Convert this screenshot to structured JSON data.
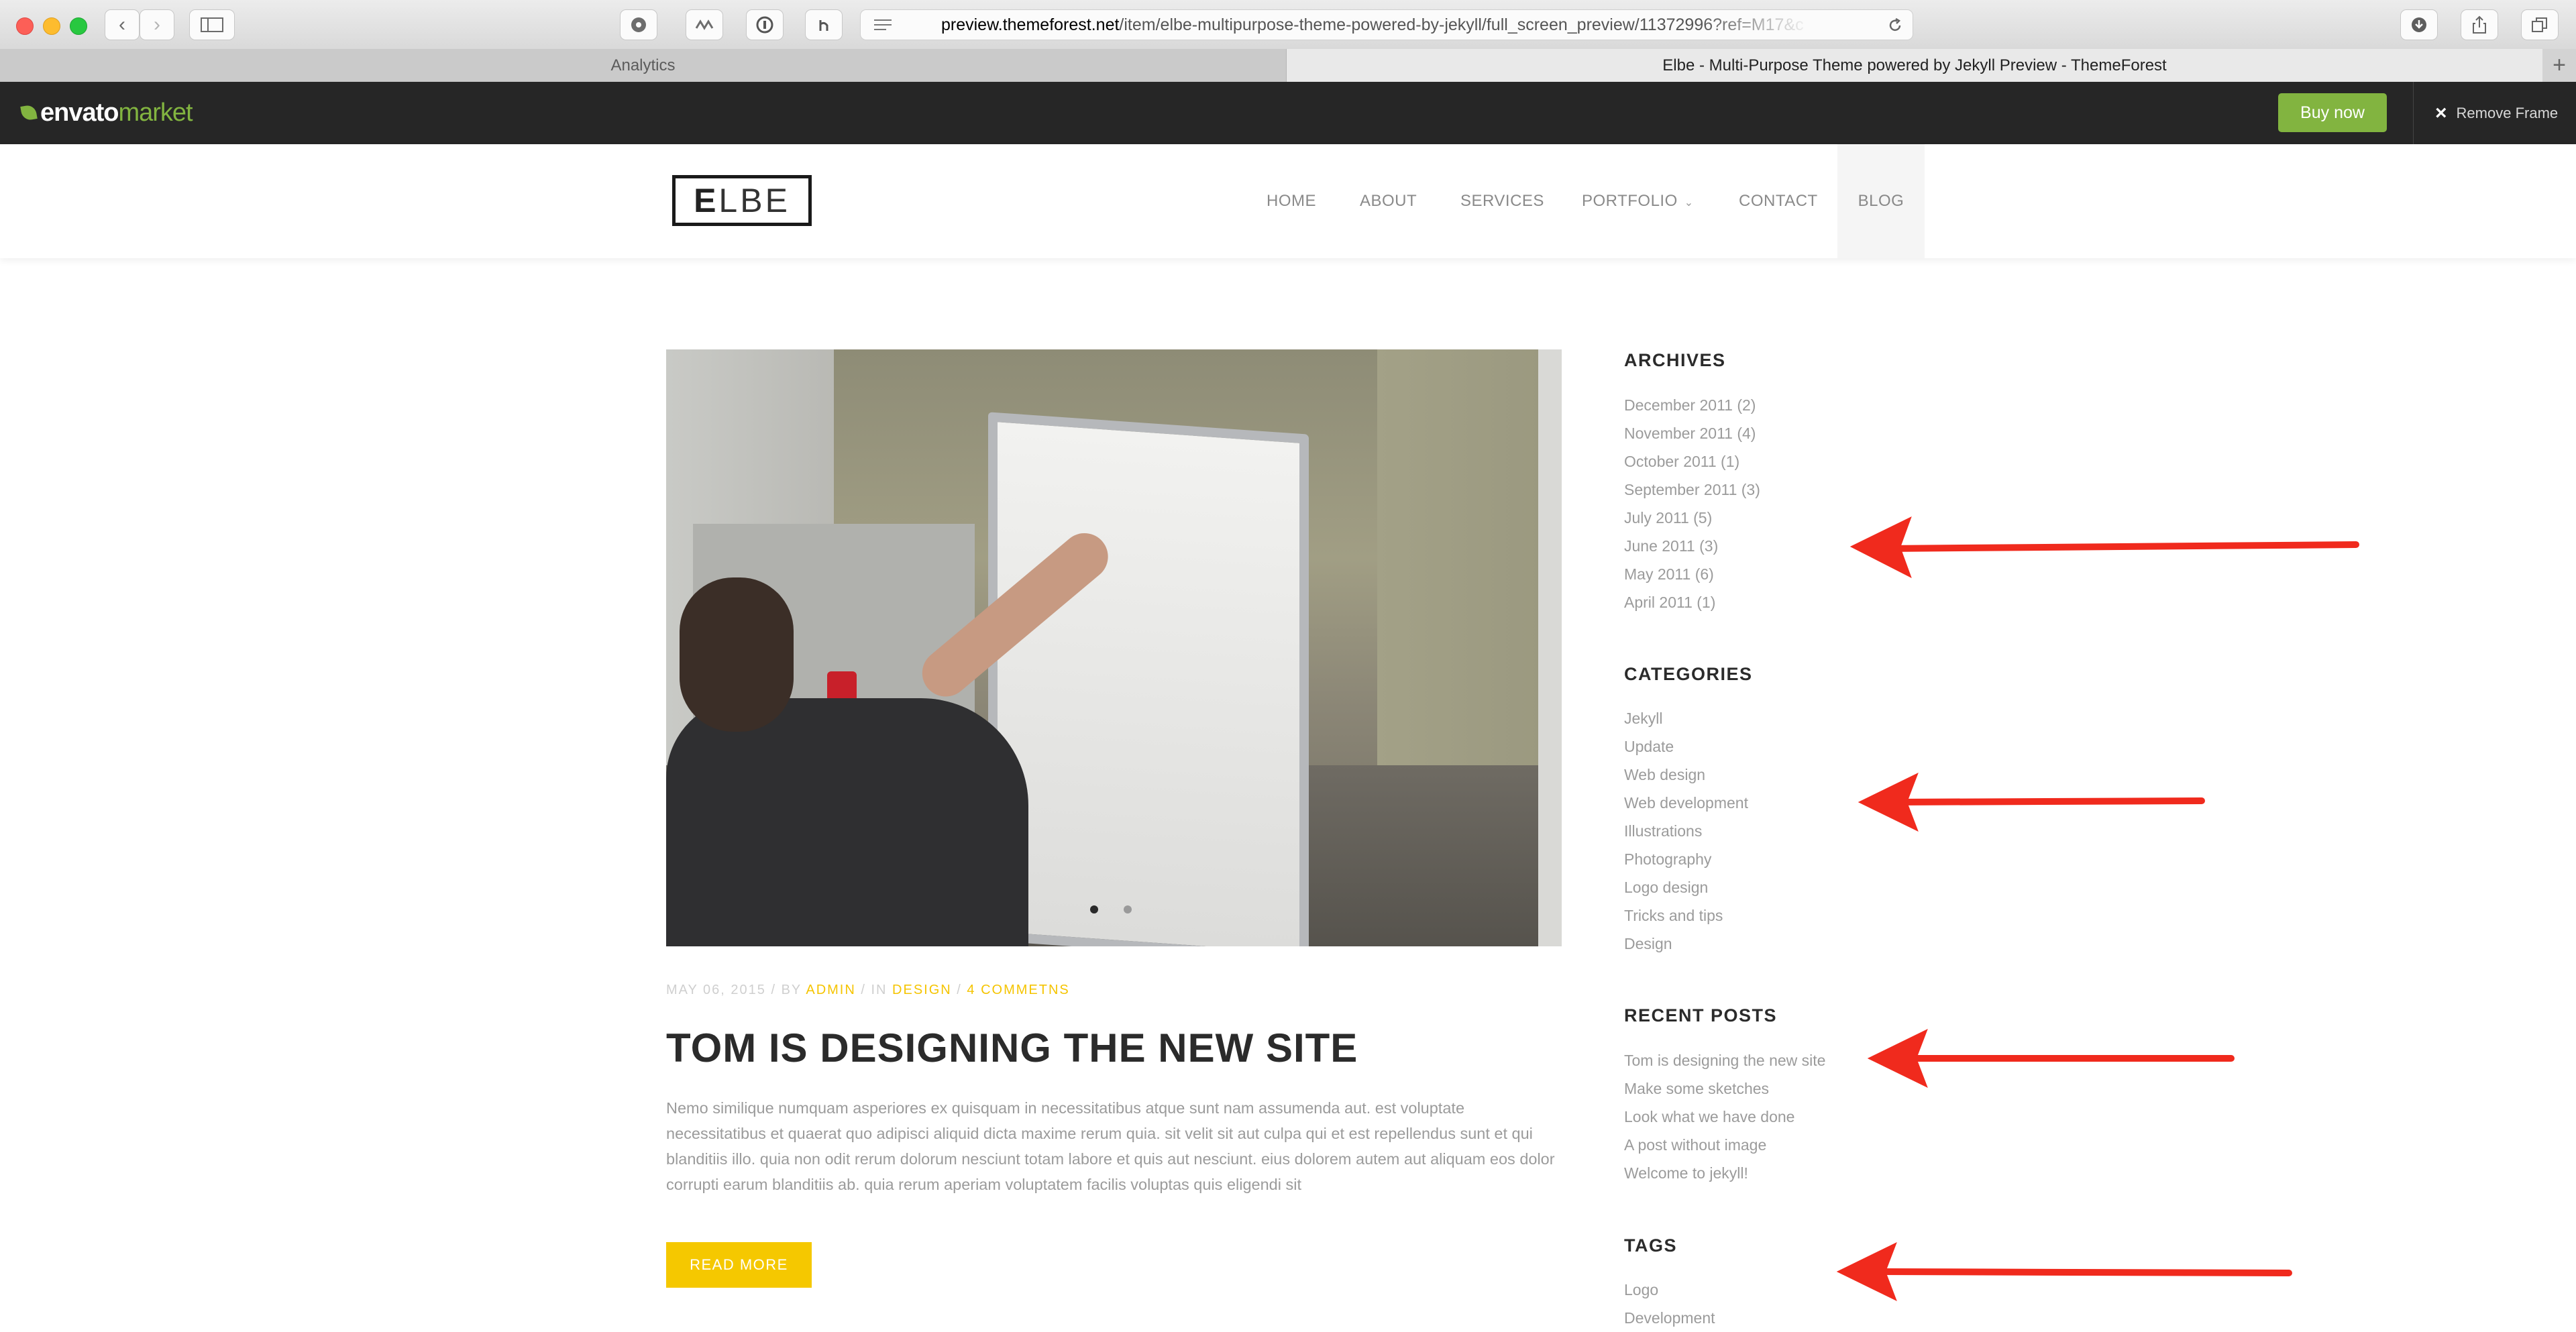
{
  "browser": {
    "url_host": "preview.themeforest.net",
    "url_path": "/item/elbe-multipurpose-theme-powered-by-jekyll/full_screen_preview/11372996?ref=M17&c",
    "tabs": [
      {
        "label": "Analytics",
        "active": false
      },
      {
        "label": "Elbe - Multi-Purpose Theme powered by Jekyll Preview - ThemeForest",
        "active": true
      }
    ],
    "new_tab_label": "+"
  },
  "envato": {
    "logo_word1": "envato",
    "logo_word2": "market",
    "buy_label": "Buy now",
    "remove_frame_label": "Remove Frame",
    "accent": "#82b440"
  },
  "site": {
    "logo_first": "E",
    "logo_rest": "LBE",
    "nav": [
      {
        "label": "HOME"
      },
      {
        "label": "ABOUT"
      },
      {
        "label": "SERVICES"
      },
      {
        "label": "PORTFOLIO"
      },
      {
        "label": "CONTACT"
      },
      {
        "label": "BLOG",
        "active": true
      }
    ]
  },
  "post": {
    "date": "MAY 06, 2015",
    "by_sep": " / BY ",
    "author": "ADMIN",
    "in_sep": " / IN ",
    "category": "DESIGN",
    "comments_sep": " / ",
    "comments": "4 COMMETNS",
    "title": "TOM IS DESIGNING THE NEW SITE",
    "excerpt": "Nemo similique numquam asperiores ex quisquam in necessitatibus atque sunt nam assumenda aut. est voluptate necessitatibus et quaerat quo adipisci aliquid dicta maxime rerum quia. sit velit sit aut culpa qui et est repellendus sunt et qui blanditiis illo. quia non odit rerum dolorum nesciunt totam labore et quis aut nesciunt. eius dolorem autem aut aliquam eos dolor corrupti earum blanditiis ab. quia rerum aperiam voluptatem facilis voluptas quis eligendi sit",
    "read_more": "READ MORE",
    "accent": "#f5c800"
  },
  "sidebar": {
    "archives": {
      "title": "ARCHIVES",
      "items": [
        "December 2011 (2)",
        "November 2011 (4)",
        "October 2011 (1)",
        "September 2011 (3)",
        "July 2011 (5)",
        "June 2011 (3)",
        "May 2011 (6)",
        "April 2011 (1)"
      ]
    },
    "categories": {
      "title": "CATEGORIES",
      "items": [
        "Jekyll",
        "Update",
        "Web design",
        "Web development",
        "Illustrations",
        "Photography",
        "Logo design",
        "Tricks and tips",
        "Design"
      ]
    },
    "recent_posts": {
      "title": "RECENT POSTS",
      "items": [
        "Tom is designing the new site",
        "Make some sketches",
        "Look what we have done",
        "A post without image",
        "Welcome to jekyll!"
      ]
    },
    "tags": {
      "title": "TAGS",
      "items": [
        "Logo",
        "Development"
      ]
    }
  },
  "annotation_color": "#f02a1d"
}
